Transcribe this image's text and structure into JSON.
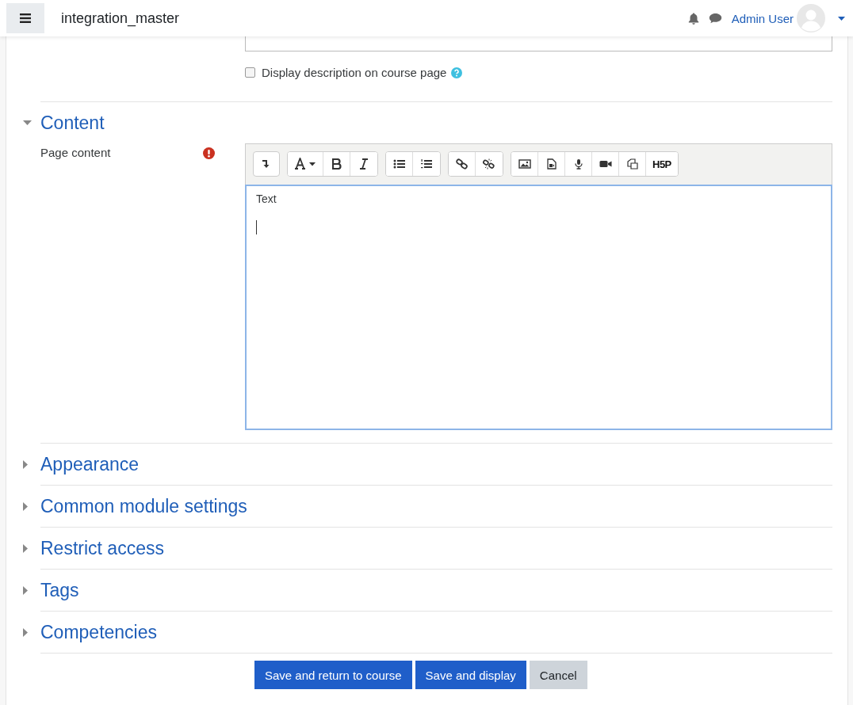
{
  "navbar": {
    "site_name": "integration_master",
    "user_name": "Admin User"
  },
  "description": {
    "show_on_course_page": {
      "label": "Display description on course page",
      "checked": false
    }
  },
  "sections": [
    {
      "title": "Content",
      "expanded": true,
      "field": {
        "label": "Page content",
        "required": true,
        "toolbar": [
          {
            "buttons": [
              {
                "kind": "collapse"
              }
            ]
          },
          {
            "buttons": [
              {
                "kind": "font"
              },
              {
                "kind": "bold"
              },
              {
                "kind": "italic"
              }
            ]
          },
          {
            "buttons": [
              {
                "kind": "bullets"
              },
              {
                "kind": "numbers"
              }
            ]
          },
          {
            "buttons": [
              {
                "kind": "link"
              },
              {
                "kind": "unlink"
              }
            ]
          },
          {
            "buttons": [
              {
                "kind": "image"
              },
              {
                "kind": "media"
              },
              {
                "kind": "audio"
              },
              {
                "kind": "video"
              },
              {
                "kind": "copy"
              },
              {
                "kind": "text",
                "label": "H5P"
              }
            ]
          }
        ],
        "value": "Text"
      }
    },
    {
      "title": "Appearance",
      "expanded": false
    },
    {
      "title": "Common module settings",
      "expanded": false
    },
    {
      "title": "Restrict access",
      "expanded": false
    },
    {
      "title": "Tags",
      "expanded": false
    },
    {
      "title": "Competencies",
      "expanded": false
    }
  ],
  "buttons": [
    {
      "label": "Save and return to course",
      "kind": "primary"
    },
    {
      "label": "Save and display",
      "kind": "primary"
    },
    {
      "label": "Cancel",
      "kind": "secondary"
    }
  ]
}
